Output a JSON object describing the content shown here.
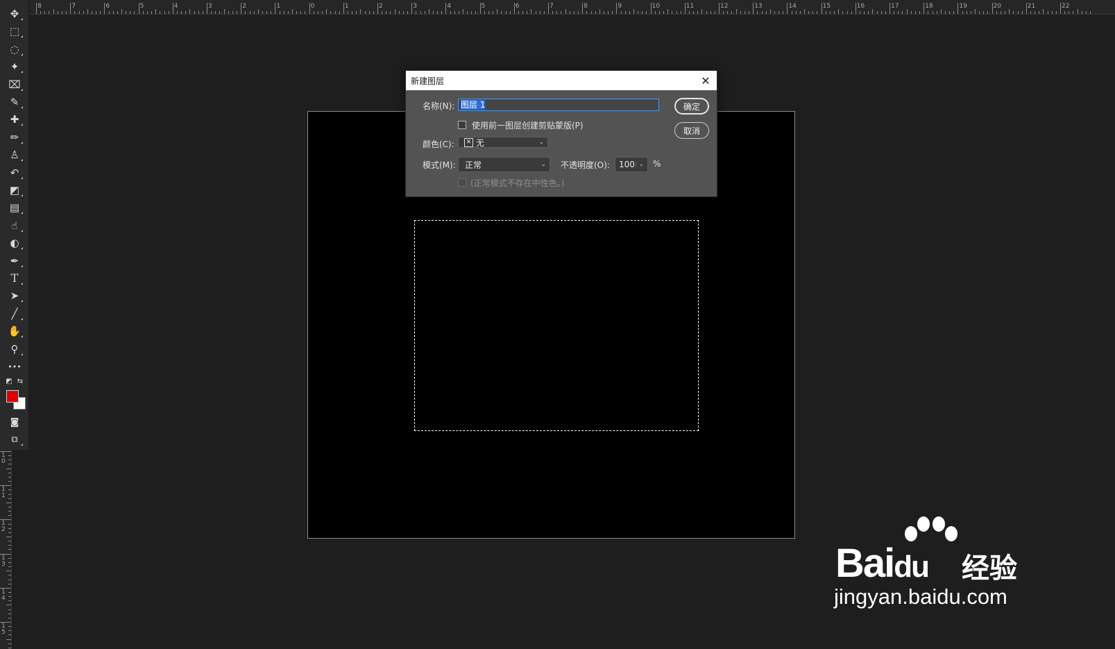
{
  "ruler": {
    "top_labels": [
      "8",
      "7",
      "6",
      "5",
      "4",
      "3",
      "2",
      "1",
      "0",
      "1",
      "2",
      "3",
      "4",
      "5",
      "6",
      "7",
      "8",
      "9",
      "10",
      "11",
      "12",
      "13",
      "14",
      "15",
      "16",
      "17",
      "18",
      "19",
      "20",
      "21",
      "22"
    ],
    "left_labels": [
      "1 0",
      "1 1",
      "1 2",
      "1 3",
      "1 4",
      "1 5"
    ]
  },
  "toolbar": {
    "tools": [
      {
        "name": "move-tool",
        "glyph": "✥"
      },
      {
        "name": "rectangular-marquee-tool",
        "glyph": "⬚"
      },
      {
        "name": "lasso-tool",
        "glyph": "◌"
      },
      {
        "name": "magic-wand-tool",
        "glyph": "✦"
      },
      {
        "name": "crop-tool",
        "glyph": "⌧"
      },
      {
        "name": "eyedropper-tool",
        "glyph": "✎"
      },
      {
        "name": "healing-brush-tool",
        "glyph": "✚"
      },
      {
        "name": "brush-tool",
        "glyph": "✏"
      },
      {
        "name": "clone-stamp-tool",
        "glyph": "♙"
      },
      {
        "name": "history-brush-tool",
        "glyph": "↶"
      },
      {
        "name": "eraser-tool",
        "glyph": "◩"
      },
      {
        "name": "gradient-tool",
        "glyph": "▤"
      },
      {
        "name": "smudge-tool",
        "glyph": "☝"
      },
      {
        "name": "dodge-tool",
        "glyph": "◐"
      },
      {
        "name": "pen-tool",
        "glyph": "✒"
      },
      {
        "name": "type-tool",
        "glyph": "T"
      },
      {
        "name": "path-selection-tool",
        "glyph": "➤"
      },
      {
        "name": "line-tool",
        "glyph": "╱"
      },
      {
        "name": "hand-tool",
        "glyph": "✋"
      },
      {
        "name": "zoom-tool",
        "glyph": "⚲"
      },
      {
        "name": "more-tools",
        "glyph": "•••"
      }
    ],
    "foreground_color": "#e00000",
    "background_color": "#ffffff"
  },
  "dialog": {
    "title": "新建图层",
    "name_label": "名称(N):",
    "name_value": "图层 1",
    "clip_label": "使用前一图层创建剪贴蒙版(P)",
    "color_label": "颜色(C):",
    "color_value": "无",
    "mode_label": "模式(M):",
    "mode_value": "正常",
    "opacity_label": "不透明度(O):",
    "opacity_value": "100",
    "opacity_unit": "%",
    "neutral_label": "(正常模式不存在中性色。)",
    "ok_label": "确定",
    "cancel_label": "取消"
  },
  "watermark": {
    "brand": "Bai",
    "brand_du": "du",
    "brand_cn": "经验",
    "url": "jingyan.baidu.com"
  }
}
